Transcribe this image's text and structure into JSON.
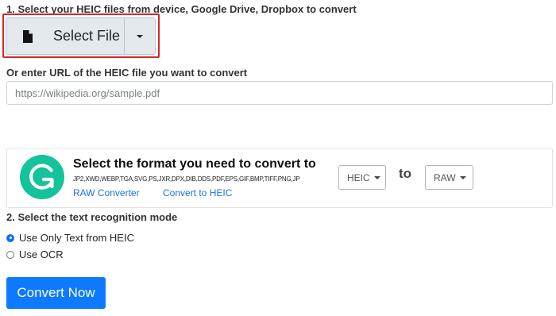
{
  "step1": {
    "label": "1. Select your HEIC files from device, Google Drive, Dropbox to convert",
    "select_file_label": "Select File",
    "file_icon": "file-icon",
    "dropdown_icon": "caret-down-icon"
  },
  "url_section": {
    "label": "Or enter URL of the HEIC file you want to convert",
    "placeholder": "https://wikipedia.org/sample.pdf",
    "value": ""
  },
  "format_panel": {
    "logo_icon": "g-logo-icon",
    "title": "Select the format you need to convert to",
    "formats": "JP2,XWD,WEBP,TGA,SVG,PS,JXR,DPX,DIB,DDS,PDF,EPS,GIF,BMP,TIFF,PNG,JP",
    "link_raw": "RAW Converter",
    "link_heic": "Convert to HEIC",
    "from_format": "HEIC",
    "to_label": "to",
    "to_format": "RAW"
  },
  "step2": {
    "label": "2. Select the text recognition mode",
    "options": [
      {
        "label": "Use Only Text from HEIC",
        "checked": true
      },
      {
        "label": "Use OCR",
        "checked": false
      }
    ]
  },
  "convert_button_label": "Convert Now",
  "colors": {
    "highlight": "#d9262c",
    "primary": "#0d7aff",
    "link": "#1a73e8",
    "logo": "#15c39a"
  }
}
